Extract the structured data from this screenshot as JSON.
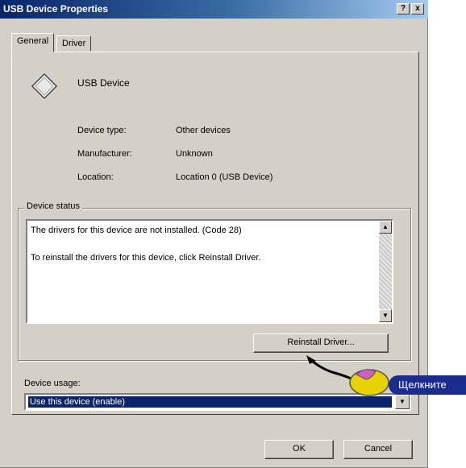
{
  "window": {
    "title": "USB Device Properties",
    "help_btn": "?",
    "close_btn": "x"
  },
  "tabs": [
    {
      "label": "General",
      "active": true
    },
    {
      "label": "Driver",
      "active": false
    }
  ],
  "device": {
    "name": "USB Device",
    "rows": [
      {
        "label": "Device type:",
        "value": "Other devices"
      },
      {
        "label": "Manufacturer:",
        "value": "Unknown"
      },
      {
        "label": "Location:",
        "value": "Location 0 (USB Device)"
      }
    ],
    "icon": "usb-device-icon"
  },
  "status": {
    "group_label": "Device status",
    "line1": "The drivers for this device are not installed. (Code 28)",
    "line2": "To reinstall the drivers for this device, click Reinstall Driver.",
    "reinstall_button": "Reinstall Driver..."
  },
  "usage": {
    "label": "Device usage:",
    "selected": "Use this device (enable)"
  },
  "buttons": {
    "ok": "OK",
    "cancel": "Cancel"
  },
  "annotation": {
    "callout_text": "Щелкните",
    "callout_color": "#1a2c8e",
    "mouse_color": "#e6d200"
  }
}
